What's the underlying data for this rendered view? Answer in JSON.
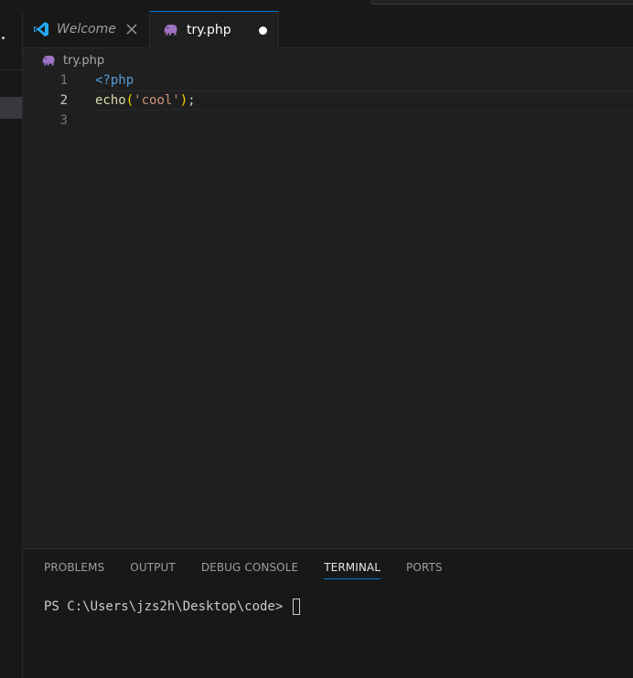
{
  "tabs": {
    "welcome": {
      "label": "Welcome",
      "icon": "vscode-logo-icon"
    },
    "active": {
      "label": "try.php",
      "icon": "php-elephant-icon",
      "modified": true
    }
  },
  "breadcrumb": {
    "file": "try.php",
    "icon": "php-elephant-icon"
  },
  "editor": {
    "current_line": 2,
    "lines": [
      {
        "number": "1",
        "tokens": {
          "tag": "<?php"
        }
      },
      {
        "number": "2",
        "tokens": {
          "fn": "echo",
          "open": "(",
          "str": "'cool'",
          "close": ")",
          "semi": ";"
        }
      },
      {
        "number": "3"
      }
    ]
  },
  "panel": {
    "tabs": [
      {
        "label": "PROBLEMS"
      },
      {
        "label": "OUTPUT"
      },
      {
        "label": "DEBUG CONSOLE"
      },
      {
        "label": "TERMINAL",
        "active": true
      },
      {
        "label": "PORTS"
      }
    ],
    "terminal": {
      "prompt": "PS C:\\Users\\jzs2h\\Desktop\\code> "
    }
  },
  "colors": {
    "accent": "#0078d4",
    "php_icon": "#a074c4",
    "vscode_icon": "#23a9f2"
  }
}
